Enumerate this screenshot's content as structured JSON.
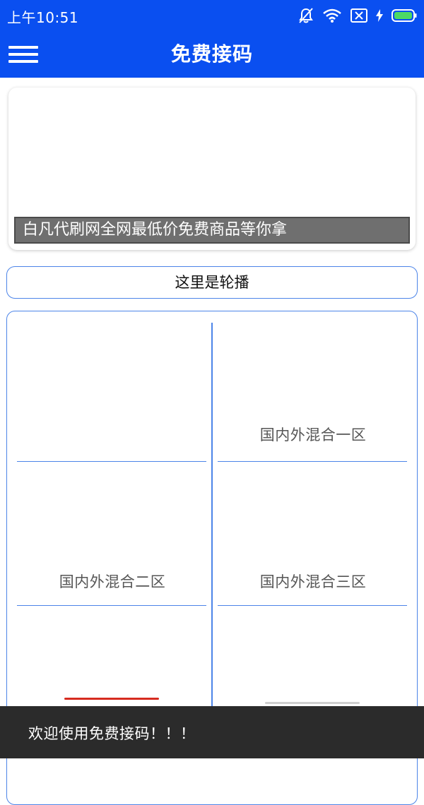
{
  "status_bar": {
    "time": "上午10:51",
    "icons": [
      "notifications-off-icon",
      "wifi-icon",
      "sim-disabled-icon",
      "charging-bolt-icon",
      "battery-icon"
    ]
  },
  "app_bar": {
    "title": "免费接码",
    "menu_icon": "hamburger-menu-icon",
    "color": "#0a4ff0"
  },
  "banner": {
    "caption": "白凡代刷网全网最低价免费商品等你拿"
  },
  "carousel": {
    "label": "这里是轮播"
  },
  "regions": [
    {
      "label": ""
    },
    {
      "label": "国内外混合一区"
    },
    {
      "label": "国内外混合二区"
    },
    {
      "label": "国内外混合三区"
    },
    {
      "label": ""
    },
    {
      "label": ""
    }
  ],
  "toast": {
    "message": "欢迎使用免费接码！！！"
  },
  "colors": {
    "accent": "#0a4ff0",
    "border": "#4c84e8",
    "toast_bg": "#2b2b2b",
    "red_accent": "#d62b1f"
  }
}
